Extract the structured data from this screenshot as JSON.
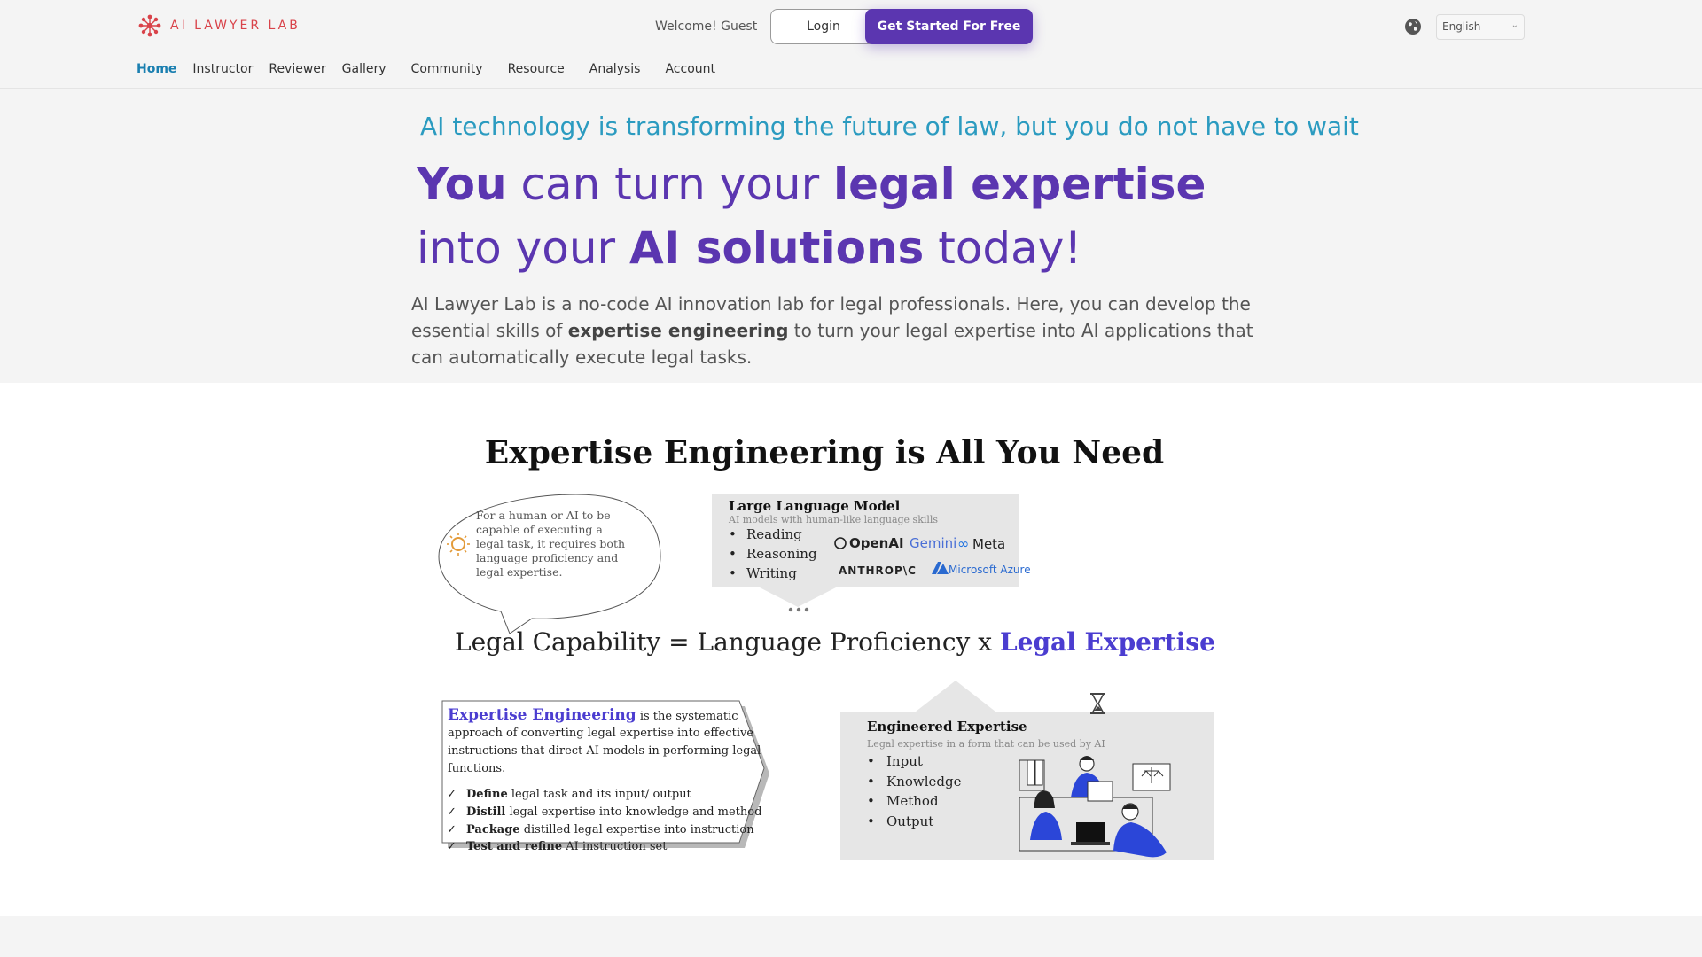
{
  "header": {
    "brand": "AI LAWYER LAB",
    "welcome": "Welcome! Guest",
    "login_label": "Login",
    "start_label": "Get Started For Free",
    "language": "English",
    "brand_color": "#d9434a",
    "accent_color": "#5b36b0"
  },
  "nav": [
    {
      "label": "Home",
      "active": true
    },
    {
      "label": "Instructor"
    },
    {
      "label": "Reviewer"
    },
    {
      "label": "Gallery"
    },
    {
      "label": "Community"
    },
    {
      "label": "Resource"
    },
    {
      "label": "Analysis"
    },
    {
      "label": "Account"
    }
  ],
  "hero": {
    "tagline": "AI technology is transforming the future of law, but you do not have to wait",
    "headline": {
      "p1": "You",
      "p2": " can turn your ",
      "p3": "legal expertise",
      "p4": " into your ",
      "p5": "AI solutions",
      "p6": " today!"
    },
    "lead": {
      "p1": "AI Lawyer Lab is a no-code AI innovation lab for legal professionals. Here, you can develop the essential skills of ",
      "p2": "expertise engineering",
      "p3": " to turn your legal expertise into AI applications that can automatically execute legal tasks."
    }
  },
  "section": {
    "title": "Expertise Engineering is All You Need"
  },
  "diagram": {
    "bubble_text": [
      "For a human or AI to be",
      "capable of executing a",
      "legal task, it requires both",
      "language proficiency and",
      "legal expertise."
    ],
    "llm_title": "Large Language  Model",
    "llm_subtitle": "AI models with human-like language skills",
    "llm_items": [
      "Reading",
      "Reasoning",
      "Writing"
    ],
    "logos": [
      "OpenAI",
      "Gemini",
      "Meta",
      "ANTHROP\\C",
      "Microsoft Azure"
    ],
    "equation_left": "Legal Capability = Language Proficiency x ",
    "equation_right": "Legal Expertise",
    "ee_title": "Expertise Engineering",
    "ee_desc": [
      " is the systematic",
      "approach of converting legal expertise into effective",
      "instructions that direct AI models in performing legal",
      "functions."
    ],
    "ee_steps": [
      {
        "bold": "Define",
        "text": " legal task and its input/ output"
      },
      {
        "bold": "Distill",
        "text": " legal expertise into knowledge  and method"
      },
      {
        "bold": "Package",
        "text": " distilled legal expertise into instruction"
      },
      {
        "bold": "Test and refine",
        "text": " AI instruction set"
      }
    ],
    "eng_title": "Engineered Expertise",
    "eng_subtitle": "Legal expertise in a form that can be used by AI",
    "eng_items": [
      "Input",
      "Knowledge",
      "Method",
      "Output"
    ]
  }
}
